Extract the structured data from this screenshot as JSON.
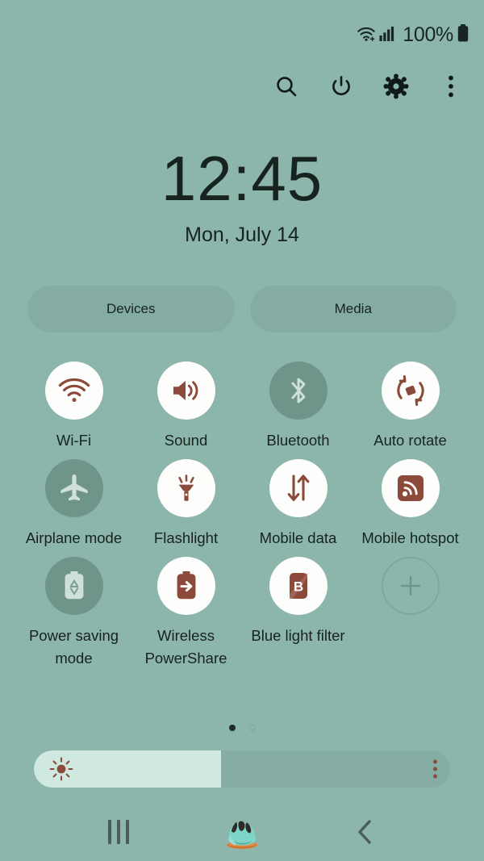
{
  "status_bar": {
    "wifi_icon": "wifi-plus-icon",
    "signal_icon": "cellular-signal-icon",
    "battery_percent": "100%",
    "battery_icon": "battery-full-icon"
  },
  "header_icons": [
    {
      "name": "search-icon",
      "label": "Search"
    },
    {
      "name": "power-icon",
      "label": "Power"
    },
    {
      "name": "settings-gear-icon",
      "label": "Settings"
    },
    {
      "name": "more-options-icon",
      "label": "More options"
    }
  ],
  "clock": {
    "time": "12:45",
    "date": "Mon, July 14"
  },
  "pills": [
    {
      "label": "Devices"
    },
    {
      "label": "Media"
    }
  ],
  "tiles": [
    {
      "label": "Wi-Fi",
      "icon": "wifi-icon",
      "state": "on"
    },
    {
      "label": "Sound",
      "icon": "sound-icon",
      "state": "on"
    },
    {
      "label": "Bluetooth",
      "icon": "bluetooth-icon",
      "state": "off"
    },
    {
      "label": "Auto rotate",
      "icon": "auto-rotate-icon",
      "state": "on"
    },
    {
      "label": "Airplane mode",
      "icon": "airplane-icon",
      "state": "off"
    },
    {
      "label": "Flashlight",
      "icon": "flashlight-icon",
      "state": "on"
    },
    {
      "label": "Mobile data",
      "icon": "mobile-data-icon",
      "state": "on"
    },
    {
      "label": "Mobile hotspot",
      "icon": "mobile-hotspot-icon",
      "state": "on"
    },
    {
      "label": "Power saving mode",
      "icon": "power-saving-icon",
      "state": "off"
    },
    {
      "label": "Wireless PowerShare",
      "icon": "wireless-powershare-icon",
      "state": "on"
    },
    {
      "label": "Blue light filter",
      "icon": "blue-light-filter-icon",
      "state": "on"
    },
    {
      "label": "",
      "icon": "add-icon",
      "state": "add"
    }
  ],
  "pagination": {
    "total": 2,
    "current": 1
  },
  "brightness": {
    "value_percent": 45,
    "sun_icon": "brightness-sun-icon",
    "menu_icon": "brightness-options-icon"
  },
  "nav_bar": [
    {
      "name": "recents-button",
      "icon": "recents-icon"
    },
    {
      "name": "home-button",
      "icon": "melting-home-icon"
    },
    {
      "name": "back-button",
      "icon": "back-chevron-icon"
    }
  ],
  "colors": {
    "background": "#8cb5ac",
    "tile_on": "#fdfdfb",
    "tile_off": "#6f958a",
    "accent_brown": "#8b4a3a",
    "slider_fill": "#cfe9e1",
    "text": "#16231f"
  }
}
